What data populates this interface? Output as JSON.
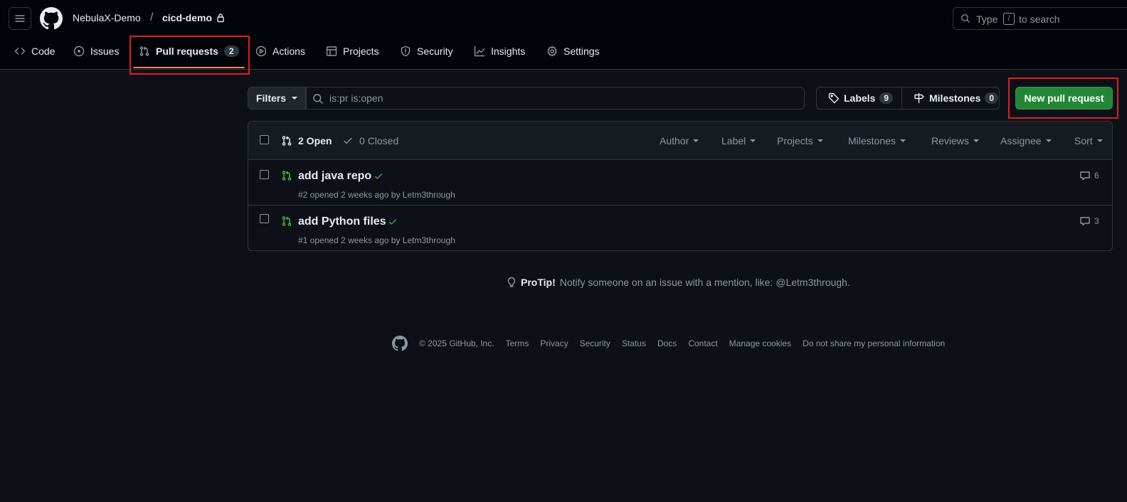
{
  "header": {
    "owner": "NebulaX-Demo",
    "separator": "/",
    "repo": "cicd-demo",
    "search": {
      "prefix": "Type",
      "key": "/",
      "suffix": "to search"
    }
  },
  "tabs": [
    {
      "label": "Code",
      "icon": "code-icon"
    },
    {
      "label": "Issues",
      "icon": "issue-opened-icon"
    },
    {
      "label": "Pull requests",
      "icon": "git-pull-request-icon",
      "count": "2",
      "active": true
    },
    {
      "label": "Actions",
      "icon": "play-icon"
    },
    {
      "label": "Projects",
      "icon": "table-icon"
    },
    {
      "label": "Security",
      "icon": "shield-icon"
    },
    {
      "label": "Insights",
      "icon": "graph-icon"
    },
    {
      "label": "Settings",
      "icon": "gear-icon"
    }
  ],
  "toolbar": {
    "filters_label": "Filters",
    "filter_query": "is:pr is:open",
    "labels": {
      "label": "Labels",
      "count": "9"
    },
    "milestones": {
      "label": "Milestones",
      "count": "0"
    },
    "new_pr_label": "New pull request"
  },
  "list": {
    "open_label": "2 Open",
    "closed_label": "0 Closed",
    "filters": [
      "Author",
      "Label",
      "Projects",
      "Milestones",
      "Reviews",
      "Assignee",
      "Sort"
    ],
    "items": [
      {
        "title": "add java repo",
        "meta": "#2 opened 2 weeks ago by Letm3through",
        "comments": "6",
        "status": "check-icon"
      },
      {
        "title": "add Python files",
        "meta": "#1 opened 2 weeks ago by Letm3through",
        "comments": "3",
        "status": "check-icon"
      }
    ]
  },
  "protip": {
    "label": "ProTip!",
    "text": "Notify someone on an issue with a mention, like: @Letm3through."
  },
  "footer": {
    "copyright": "© 2025 GitHub, Inc.",
    "links": [
      "Terms",
      "Privacy",
      "Security",
      "Status",
      "Docs",
      "Contact",
      "Manage cookies",
      "Do not share my personal information"
    ]
  },
  "colors": {
    "accent": "#238636",
    "open": "#3fb950",
    "underline": "#f78166",
    "annotation": "#e01e1e"
  }
}
